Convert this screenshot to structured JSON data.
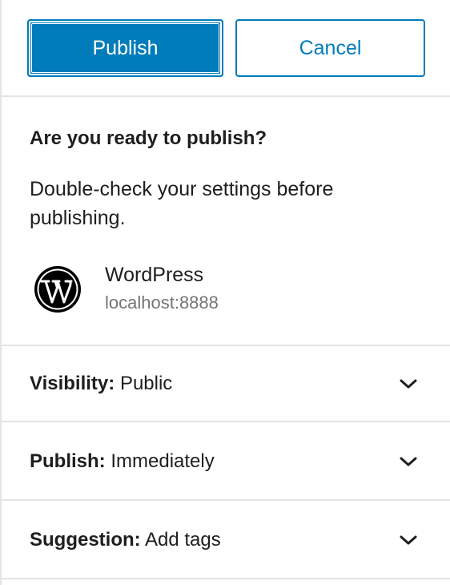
{
  "header": {
    "publish_label": "Publish",
    "cancel_label": "Cancel"
  },
  "intro": {
    "title": "Are you ready to publish?",
    "text": "Double-check your settings before publishing."
  },
  "site": {
    "icon": "wordpress-icon",
    "name": "WordPress",
    "url": "localhost:8888"
  },
  "panels": [
    {
      "key": "Visibility:",
      "value": "Public"
    },
    {
      "key": "Publish:",
      "value": "Immediately"
    },
    {
      "key": "Suggestion:",
      "value": "Add tags"
    }
  ],
  "colors": {
    "accent": "#007cba",
    "divider": "#e2e4e7",
    "muted": "#757575"
  }
}
